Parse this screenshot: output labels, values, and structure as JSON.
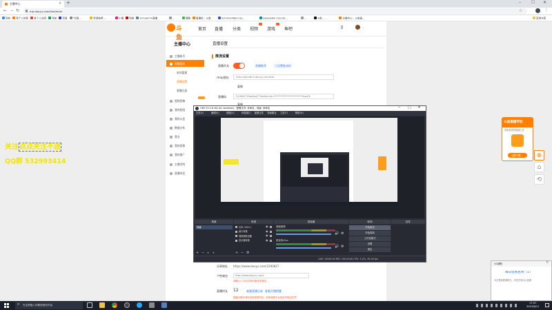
{
  "browser": {
    "tab_title": "主播中心",
    "url": "mp.douyu.com/live/main",
    "bookmarks": [
      "导航",
      "每个人的家",
      "各个人关网",
      "导航",
      "百度",
      "\"百度...",
      "赞调味精 ...",
      "小猪",
      "网易",
      "shinadmin直播",
      "...",
      "课题",
      "直播机 - 斗鱼",
      "SummonWars Sy...",
      "Liquipedia Counte...",
      "...",
      "斗鱼 - ...",
      "主播中心 - 斗鱼直...",
      "其他书签"
    ]
  },
  "site": {
    "logo_text": "斗鱼",
    "nav": [
      "首页",
      "直播",
      "分类",
      "视频",
      "游戏",
      "鱼吧"
    ],
    "user_name": "..."
  },
  "sidebar": {
    "title": "主播中心",
    "items": [
      "主播账号",
      "直播相关",
      "房间管理",
      "直播设置",
      "直播记录",
      "视频投稿",
      "我的权限",
      "我的公会",
      "数据分析",
      "营业",
      "我的招募",
      "我的推广",
      "主播学院",
      "直播伴侣"
    ]
  },
  "main": {
    "section_title": "直播设置",
    "subsection_title": "推流设置",
    "live_switch_label": "直播开关",
    "links": [
      "直播推荐",
      "已设置推流码"
    ],
    "rtmp_label": "rtmp地址",
    "rtmp_value": "rtmp://sendtc3.douyu.com/live",
    "copy_label": "复制",
    "stream_key_label": "直播码",
    "stream_key_value": "3190817rfaoSeq?7?wsSecret=***********************&wsTs",
    "share_label": "分享地址",
    "share_value": "https://www.douyu.com/3190817",
    "lottery_label": "个性域名",
    "lottery_value": "http://www.douyu.com/",
    "lottery_note": "请输入5-15位字母与数字的组合",
    "fans_label": "直播时长",
    "fans_value": "12",
    "fans_links": [
      "查看直播记录",
      "查看开播提醒"
    ],
    "warning_text": "直播过程中请勿出现违规内容，如有违规平台将给予相应处罚"
  },
  "overlay": {
    "line1_a": "关注",
    "line1_b": "点点关注不迷",
    "line2": "QQ群 532993414"
  },
  "obs": {
    "title": "OBS 25.0.8 (64 bit, windows) - 配置文件: 未命名 - 场景: 未命名",
    "menu": [
      "文件(F)",
      "编辑(E)",
      "视图(V)",
      "停靠窗口",
      "配置文件",
      "场景集合",
      "工具(T)",
      "帮助(H)"
    ],
    "docks": [
      "场景",
      "来源",
      "混音器",
      "转场",
      "控件"
    ],
    "scene_name": "场景",
    "sources": [
      "文本 (GDI+)",
      "窗口采集",
      "视频捕获设备",
      "显示器采集"
    ],
    "mixer": [
      "桌面音频",
      "麦克风/Aux"
    ],
    "controls": [
      "开始推流",
      "开始录制",
      "工作室模式",
      "设置",
      "退出"
    ],
    "status": "LIVE: 00:00:00   REC: 00:00:00   CPU: 3.2%, 30.00 fps"
  },
  "promo": {
    "title": "斗鱼直播伴侣",
    "subtitle": "简单易用的直播工具",
    "button": "立即下载"
  },
  "notify": {
    "header": "QQ通知",
    "title": "每日签到名称（1）",
    "body": "今日签到获得积分，可在任务中心查看"
  },
  "taskbar": {
    "search_placeholder": "在这里输入你要搜索的内容",
    "time": "17:07",
    "date": "2021/8/11"
  },
  "colors": {
    "brand_orange": "#ff7f00",
    "overlay_yellow": "#f5e400",
    "overlay_blue": "#3b6cff"
  }
}
